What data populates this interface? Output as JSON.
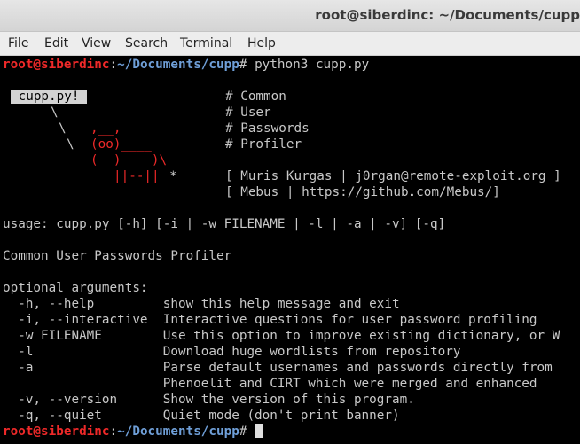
{
  "window": {
    "title": "root@siberdinc: ~/Documents/cupp"
  },
  "menu": [
    "File",
    "Edit",
    "View",
    "Search",
    "Terminal",
    "Help"
  ],
  "prompt": {
    "user_host": "root@siberdinc",
    "separator": ":",
    "path": "~/Documents/cupp",
    "symbol": "# "
  },
  "command": "python3 cupp.py",
  "banner": {
    "label": " cupp.py! ",
    "comment1": "# Common",
    "comment2": "# User",
    "comment3": "# Passwords",
    "comment4": "# Profiler",
    "credits1": "[ Muris Kurgas | j0rgan@remote-exploit.org ]",
    "credits2": "[ Mebus | https://github.com/Mebus/]"
  },
  "art": {
    "slash1": "\\",
    "slash2": "\\",
    "cow_top": ",__,",
    "slash3": "\\",
    "cow_face": "(oo)____",
    "cow_body": "(__)    )\\",
    "cow_legs": "||--||",
    "star": "*"
  },
  "usage": "usage: cupp.py [-h] [-i | -w FILENAME | -l | -a | -v] [-q]",
  "description": "Common User Passwords Profiler",
  "optional_header": "optional arguments:",
  "options": [
    "  -h, --help         show this help message and exit",
    "  -i, --interactive  Interactive questions for user password profiling",
    "  -w FILENAME        Use this option to improve existing dictionary, or W",
    "  -l                 Download huge wordlists from repository",
    "  -a                 Parse default usernames and passwords directly from",
    "                     Phenoelit and CIRT which were merged and enhanced",
    "  -v, --version      Show the version of this program.",
    "  -q, --quiet        Quiet mode (don't print banner)"
  ]
}
